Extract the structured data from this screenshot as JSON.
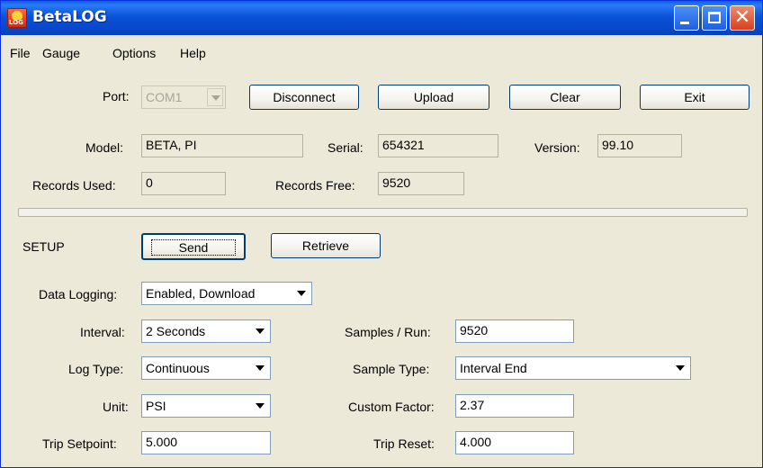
{
  "window": {
    "title": "BetaLOG",
    "icon_name": "betalog-app-icon",
    "icon_text": "LOG",
    "close_glyph": "✕"
  },
  "menu": {
    "items": [
      "File",
      "Gauge",
      "Options",
      "Help"
    ]
  },
  "connection": {
    "port_label": "Port:",
    "port_value": "COM1",
    "disconnect_label": "Disconnect",
    "upload_label": "Upload",
    "clear_label": "Clear",
    "exit_label": "Exit"
  },
  "info": {
    "model_label": "Model:",
    "model_value": "BETA, PI",
    "serial_label": "Serial:",
    "serial_value": "654321",
    "version_label": "Version:",
    "version_value": "99.10",
    "records_used_label": "Records Used:",
    "records_used_value": "0",
    "records_free_label": "Records Free:",
    "records_free_value": "9520"
  },
  "progress": {
    "fraction": 0
  },
  "setup": {
    "heading": "SETUP",
    "send_label": "Send",
    "retrieve_label": "Retrieve",
    "data_logging_label": "Data Logging:",
    "data_logging_value": "Enabled, Download",
    "interval_label": "Interval:",
    "interval_value": "2 Seconds",
    "samples_run_label": "Samples / Run:",
    "samples_run_value": "9520",
    "log_type_label": "Log Type:",
    "log_type_value": "Continuous",
    "sample_type_label": "Sample Type:",
    "sample_type_value": "Interval End",
    "unit_label": "Unit:",
    "unit_value": "PSI",
    "custom_factor_label": "Custom Factor:",
    "custom_factor_value": "2.37",
    "trip_setpoint_label": "Trip Setpoint:",
    "trip_setpoint_value": "5.000",
    "trip_reset_label": "Trip Reset:",
    "trip_reset_value": "4.000"
  },
  "colors": {
    "title_bar": "#0a52d9",
    "window_bg": "#ece9d8",
    "close_button": "#d8401f"
  }
}
